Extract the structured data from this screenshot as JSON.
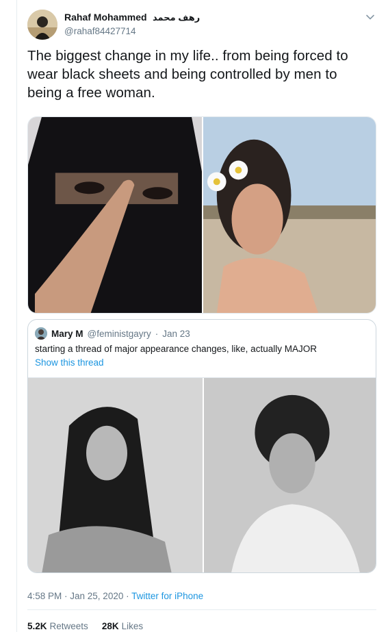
{
  "author": {
    "display_name": "Rahaf Mohammed",
    "arabic_name": "رهف محمد",
    "handle": "@rahaf84427714"
  },
  "tweet": {
    "text": "The biggest change in my life.. from being forced to wear black sheets and being controlled by men to being a free woman."
  },
  "quoted": {
    "name": "Mary M",
    "handle": "@feministgayry",
    "separator": "·",
    "date": "Jan 23",
    "text": "starting a thread of major appearance changes, like, actually MAJOR",
    "show_thread": "Show this thread"
  },
  "meta": {
    "time_date": "4:58 PM · Jan 25, 2020 · ",
    "source": "Twitter for iPhone"
  },
  "stats": {
    "retweets_count": "5.2K",
    "retweets_label": "Retweets",
    "likes_count": "28K",
    "likes_label": "Likes"
  },
  "icons": {
    "menu": "chevron-down-icon"
  },
  "colors": {
    "link": "#1b95e0",
    "secondary_text": "#657786",
    "primary_text": "#14171a"
  }
}
